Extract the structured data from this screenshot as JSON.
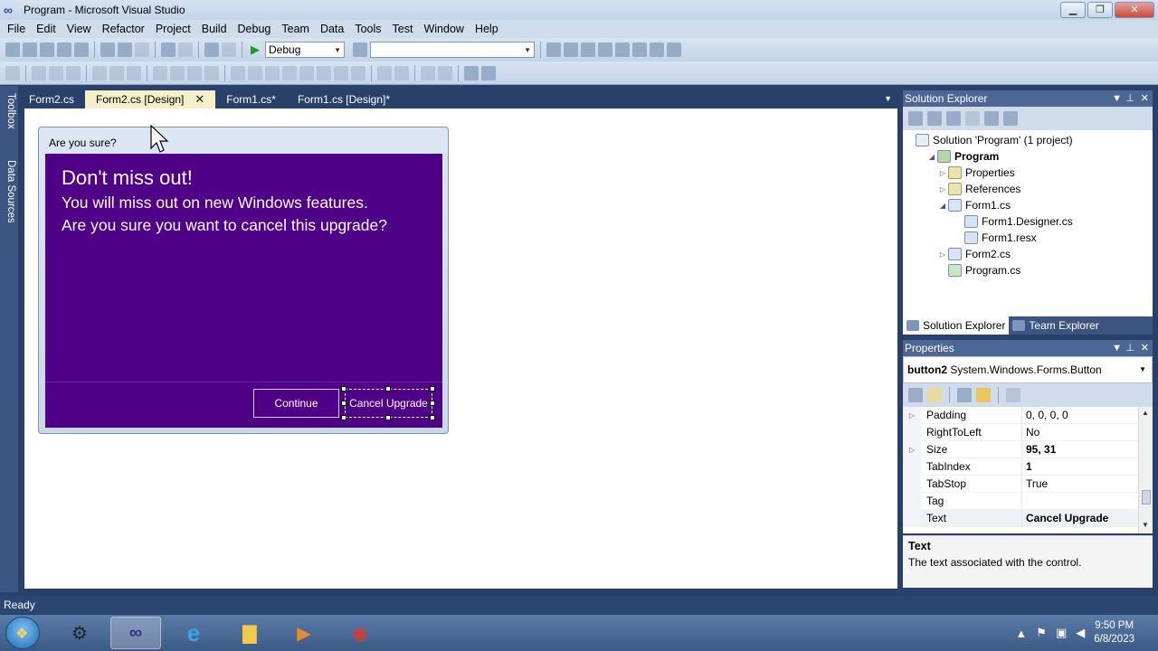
{
  "window": {
    "title": "Program - Microsoft Visual Studio",
    "app_icon": "visual-studio-icon",
    "minimize_glyph": "▁",
    "maximize_glyph": "❐",
    "close_glyph": "✕"
  },
  "menu": {
    "items": [
      "File",
      "Edit",
      "View",
      "Refactor",
      "Project",
      "Build",
      "Debug",
      "Team",
      "Data",
      "Tools",
      "Test",
      "Window",
      "Help"
    ]
  },
  "toolbar": {
    "configuration": "Debug",
    "platform": "",
    "start_glyph": "▶"
  },
  "left_strip": {
    "toolbox": "Toolbox",
    "data_sources": "Data Sources"
  },
  "doc_tabs": {
    "items": [
      "Form2.cs",
      "Form2.cs [Design]",
      "Form1.cs*",
      "Form1.cs [Design]*"
    ],
    "active_index": 1,
    "close_glyph": "✕",
    "dropdown_glyph": "▼"
  },
  "form": {
    "title": "Are you sure?",
    "heading": "Don't miss out!",
    "line1": "You will miss out on new Windows features.",
    "line2": "Are you sure you want to cancel this upgrade?",
    "continue_label": "Continue",
    "cancel_label": "Cancel Upgrade",
    "background": "#4e0087"
  },
  "solution_explorer": {
    "title": "Solution Explorer",
    "pin_glyph": "⊥",
    "nodes": {
      "solution": "Solution 'Program' (1 project)",
      "program": "Program",
      "properties": "Properties",
      "references": "References",
      "form1": "Form1.cs",
      "form1_designer": "Form1.Designer.cs",
      "form1_resx": "Form1.resx",
      "form2": "Form2.cs",
      "program_cs": "Program.cs"
    },
    "tabs": [
      "Solution Explorer",
      "Team Explorer"
    ]
  },
  "properties": {
    "title": "Properties",
    "object_name": "button2",
    "object_type": "System.Windows.Forms.Button",
    "rows": [
      {
        "name": "Padding",
        "value": "0, 0, 0, 0",
        "expandable": true,
        "bold": false
      },
      {
        "name": "RightToLeft",
        "value": "No",
        "expandable": false,
        "bold": false
      },
      {
        "name": "Size",
        "value": "95, 31",
        "expandable": true,
        "bold": true
      },
      {
        "name": "TabIndex",
        "value": "1",
        "expandable": false,
        "bold": true
      },
      {
        "name": "TabStop",
        "value": "True",
        "expandable": false,
        "bold": false
      },
      {
        "name": "Tag",
        "value": "",
        "expandable": false,
        "bold": false
      },
      {
        "name": "Text",
        "value": "Cancel Upgrade",
        "expandable": false,
        "bold": true
      }
    ],
    "description_title": "Text",
    "description_text": "The text associated with the control."
  },
  "status": {
    "text": "Ready"
  },
  "taskbar": {
    "time": "9:50 PM",
    "date": "6/8/2023"
  },
  "colors": {
    "accent": "#4d6795",
    "form_purple": "#4e0087",
    "active_tab": "#f5f0c9"
  }
}
